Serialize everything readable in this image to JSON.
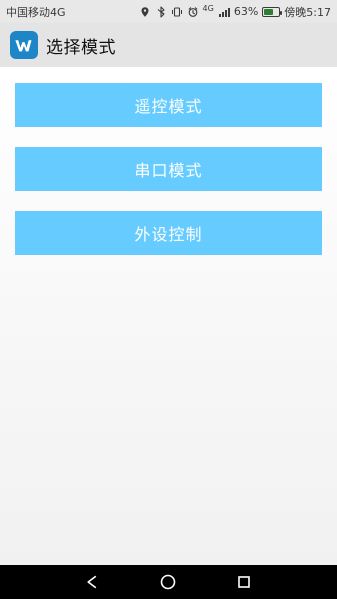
{
  "status_bar": {
    "carrier": "中国移动4G",
    "signal": "4G",
    "battery_percent": "63%",
    "battery_level": 0.63,
    "time": "傍晚5:17",
    "icons": [
      "location-icon",
      "bluetooth-icon",
      "vibrate-icon",
      "alarm-icon",
      "signal-icon",
      "battery-icon"
    ]
  },
  "title_bar": {
    "title": "选择模式",
    "logo_icon": "app-logo-icon"
  },
  "menu": {
    "buttons": [
      {
        "label": "遥控模式"
      },
      {
        "label": "串口模式"
      },
      {
        "label": "外设控制"
      }
    ]
  },
  "nav_bar": {
    "icons": [
      "back-icon",
      "home-icon",
      "recent-apps-icon"
    ]
  },
  "colors": {
    "button_bg": "#66ccff",
    "button_text": "#ffffff",
    "title_bar_bg": "#e4e4e4",
    "status_bar_bg": "#e8e8e8",
    "nav_bar_bg": "#000000",
    "logo_bg": "#1e86c6",
    "battery_fill": "#2e7d32"
  }
}
